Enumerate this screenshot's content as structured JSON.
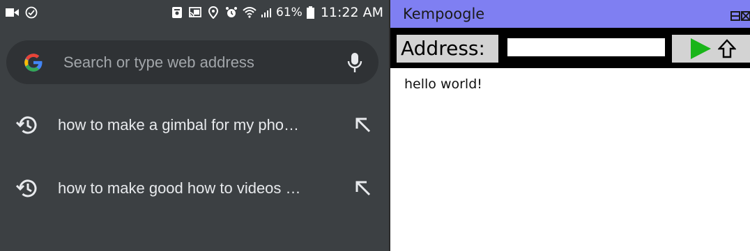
{
  "phone": {
    "status": {
      "battery": "61%",
      "time": "11:22 AM"
    },
    "omnibox": {
      "placeholder": "Search or type web address"
    },
    "suggestions": [
      {
        "text": "how to make a gimbal for my pho…"
      },
      {
        "text": "how to make good how to videos …"
      }
    ],
    "colors": {
      "background": "#3c4043",
      "omnibox": "#2f3235",
      "text": "#e8eaed",
      "placeholder": "#a2a6aa"
    },
    "icons": [
      "video-camera-icon",
      "check-circle-icon",
      "lock-icon",
      "cast-icon",
      "location-icon",
      "alarm-icon",
      "wifi-icon",
      "signal-icon",
      "battery-icon",
      "google-g-icon",
      "microphone-icon",
      "history-icon",
      "fill-arrow-icon"
    ]
  },
  "kempoogle": {
    "title": "Kempoogle",
    "address_label": "Address:",
    "address_value": "",
    "content_text": "hello world!",
    "colors": {
      "titlebar": "#7f7ff2",
      "toolbar": "#000000",
      "button": "#d3d3d3",
      "go_arrow": "#19b519"
    },
    "icons": [
      "minimize-icon",
      "close-icon",
      "go-arrow-icon",
      "home-icon"
    ]
  }
}
